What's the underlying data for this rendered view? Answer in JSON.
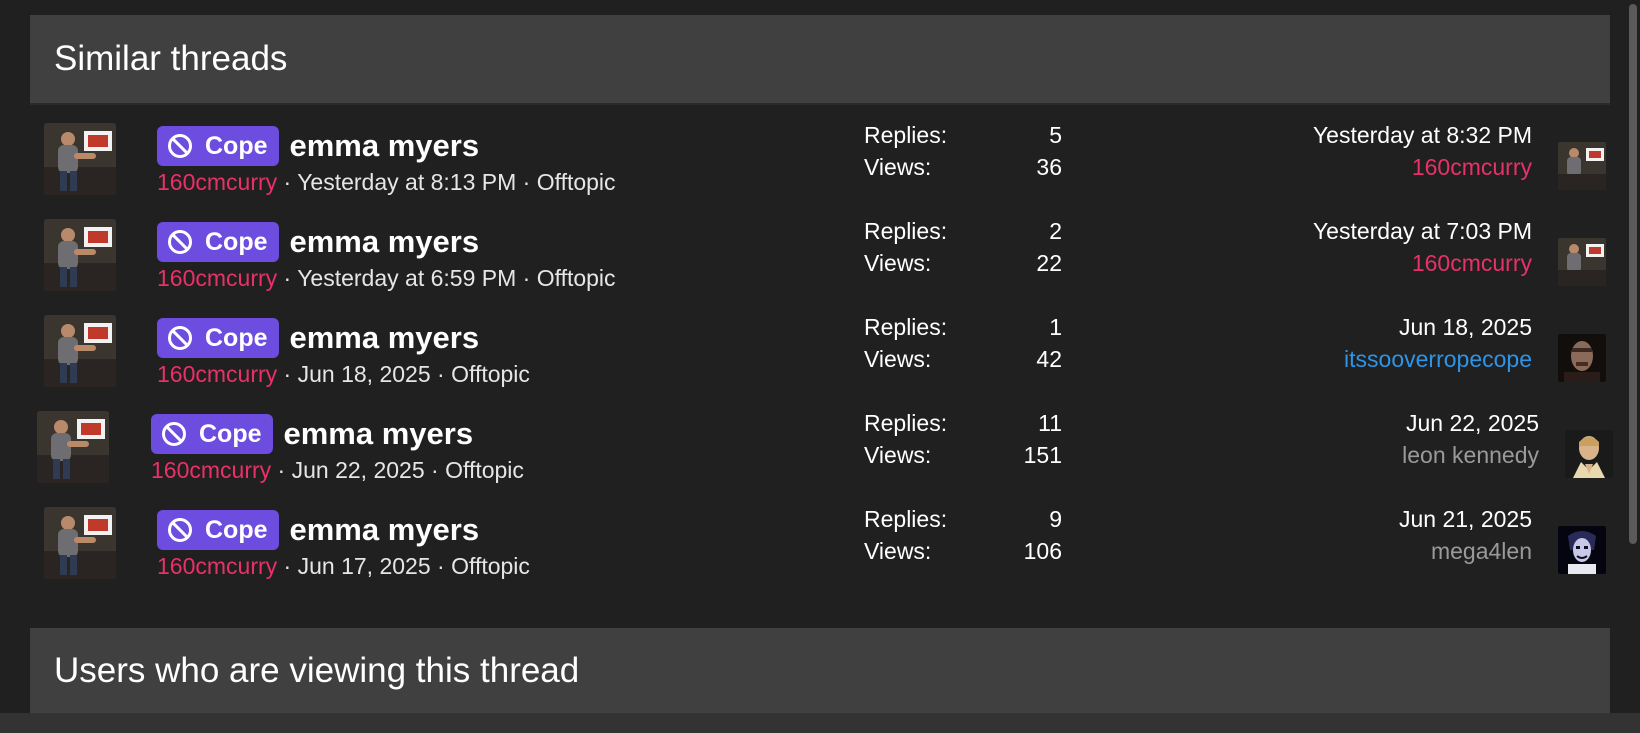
{
  "similar_threads": {
    "heading": "Similar threads",
    "threads": [
      {
        "prefix": "Cope",
        "title": "emma myers",
        "author": "160cmcurry",
        "sep1": " · ",
        "started": "Yesterday at 8:13 PM",
        "sep2": " · ",
        "forum": "Offtopic",
        "replies_label": "Replies:",
        "replies": "5",
        "views_label": "Views:",
        "views": "36",
        "last_date": "Yesterday at 8:32 PM",
        "last_user": "160cmcurry",
        "last_user_color": "red"
      },
      {
        "prefix": "Cope",
        "title": "emma myers",
        "author": "160cmcurry",
        "sep1": " · ",
        "started": "Yesterday at 6:59 PM",
        "sep2": " · ",
        "forum": "Offtopic",
        "replies_label": "Replies:",
        "replies": "2",
        "views_label": "Views:",
        "views": "22",
        "last_date": "Yesterday at 7:03 PM",
        "last_user": "160cmcurry",
        "last_user_color": "red"
      },
      {
        "prefix": "Cope",
        "title": "emma myers",
        "author": "160cmcurry",
        "sep1": " · ",
        "started": "Jun 18, 2025",
        "sep2": " · ",
        "forum": "Offtopic",
        "replies_label": "Replies:",
        "replies": "1",
        "views_label": "Views:",
        "views": "42",
        "last_date": "Jun 18, 2025",
        "last_user": "itssooverropecope",
        "last_user_color": "blue"
      },
      {
        "prefix": "Cope",
        "title": "emma myers",
        "author": "160cmcurry",
        "sep1": " · ",
        "started": "Jun 22, 2025",
        "sep2": " · ",
        "forum": "Offtopic",
        "replies_label": "Replies:",
        "replies": "11",
        "views_label": "Views:",
        "views": "151",
        "last_date": "Jun 22, 2025",
        "last_user": "leon kennedy",
        "last_user_color": "gray"
      },
      {
        "prefix": "Cope",
        "title": "emma myers",
        "author": "160cmcurry",
        "sep1": " · ",
        "started": "Jun 17, 2025",
        "sep2": " · ",
        "forum": "Offtopic",
        "replies_label": "Replies:",
        "replies": "9",
        "views_label": "Views:",
        "views": "106",
        "last_date": "Jun 21, 2025",
        "last_user": "mega4len",
        "last_user_color": "gray"
      }
    ]
  },
  "users_viewing": {
    "heading": "Users who are viewing this thread"
  },
  "colors": {
    "prefix_bg": "#6d4de0",
    "author_red": "#e8306a",
    "user_blue": "#2d94e8",
    "user_gray": "#9a9a9a",
    "header_bg": "#404040",
    "page_bg": "#202020"
  },
  "icons": {
    "prefix_icon": "ban-icon"
  }
}
